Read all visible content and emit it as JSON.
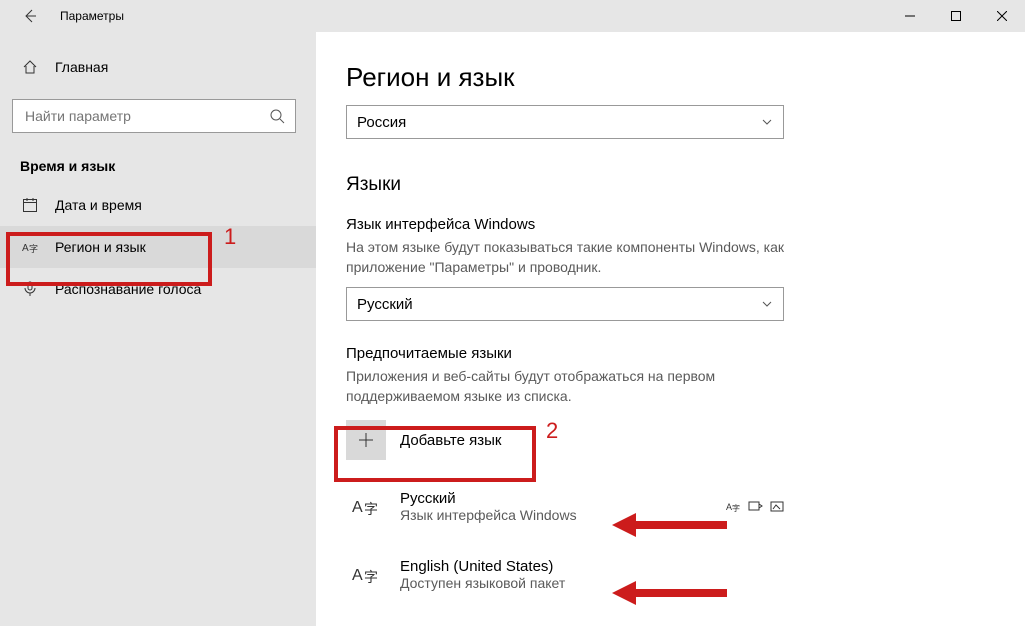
{
  "titlebar": {
    "title": "Параметры"
  },
  "sidebar": {
    "home": "Главная",
    "search_placeholder": "Найти параметр",
    "section": "Время и язык",
    "items": [
      {
        "label": "Дата и время"
      },
      {
        "label": "Регион и язык"
      },
      {
        "label": "Распознавание голоса"
      }
    ]
  },
  "main": {
    "h1": "Регион и язык",
    "region": "Россия",
    "h2_lang": "Языки",
    "ui_lang_label": "Язык интерфейса Windows",
    "ui_lang_desc": "На этом языке будут показываться такие компоненты Windows, как приложение \"Параметры\" и проводник.",
    "ui_lang_value": "Русский",
    "pref_label": "Предпочитаемые языки",
    "pref_desc": "Приложения и веб-сайты будут отображаться на первом поддерживаемом языке из списка.",
    "add_lang": "Добавьте язык",
    "languages": [
      {
        "name": "Русский",
        "sub": "Язык интерфейса Windows"
      },
      {
        "name": "English (United States)",
        "sub": "Доступен языковой пакет"
      }
    ]
  },
  "annotations": {
    "n1": "1",
    "n2": "2"
  }
}
